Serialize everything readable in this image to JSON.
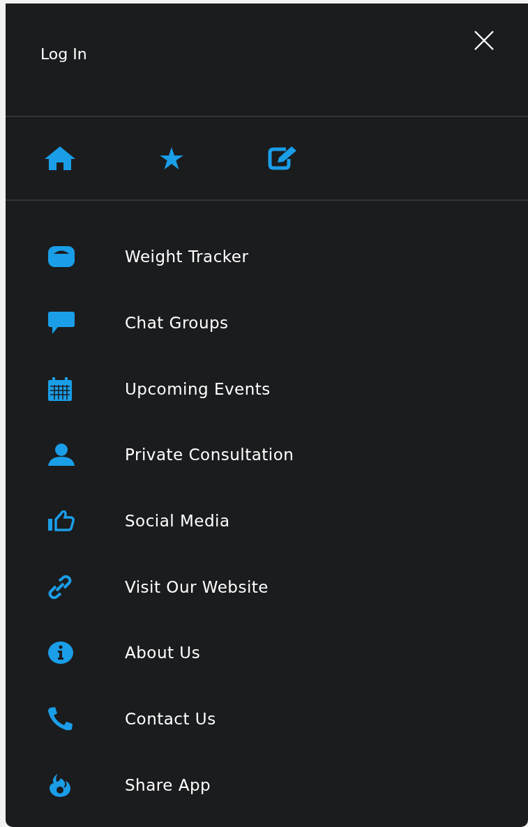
{
  "header": {
    "login": "Log In"
  },
  "menu": [
    {
      "label": "Weight Tracker"
    },
    {
      "label": "Chat Groups"
    },
    {
      "label": "Upcoming Events"
    },
    {
      "label": "Private Consultation"
    },
    {
      "label": "Social Media"
    },
    {
      "label": "Visit Our Website"
    },
    {
      "label": "About Us"
    },
    {
      "label": "Contact Us"
    },
    {
      "label": "Share App"
    }
  ]
}
